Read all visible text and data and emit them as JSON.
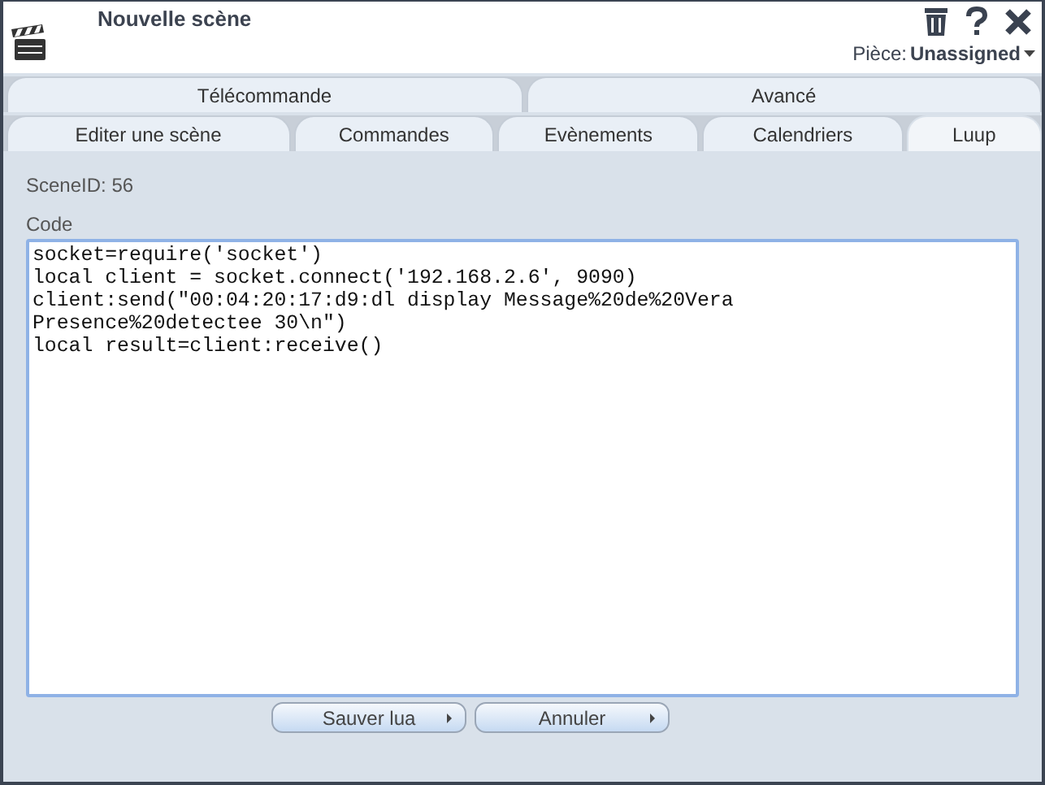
{
  "window": {
    "title": "Nouvelle scène",
    "room_label": "Pièce:",
    "room_value": "Unassigned"
  },
  "tab_rows": [
    [
      {
        "label": "Télécommande",
        "selected": false
      },
      {
        "label": "Avancé",
        "selected": false
      }
    ],
    [
      {
        "label": "Editer une scène",
        "selected": false
      },
      {
        "label": "Commandes",
        "selected": false
      },
      {
        "label": "Evènements",
        "selected": false
      },
      {
        "label": "Calendriers",
        "selected": false
      },
      {
        "label": "Luup",
        "selected": true
      }
    ]
  ],
  "scene_id": "SceneID: 56",
  "code": {
    "label": "Code",
    "lines": [
      "socket=require('socket')",
      "local client = socket.connect('192.168.2.6', 9090)",
      "client:send(\"00:04:20:17:d9:dl display Message%20de%20Vera",
      "Presence%20detectee 30\\n\")",
      "local result=client:receive()"
    ]
  },
  "buttons": [
    "Sauver lua",
    "Annuler"
  ]
}
